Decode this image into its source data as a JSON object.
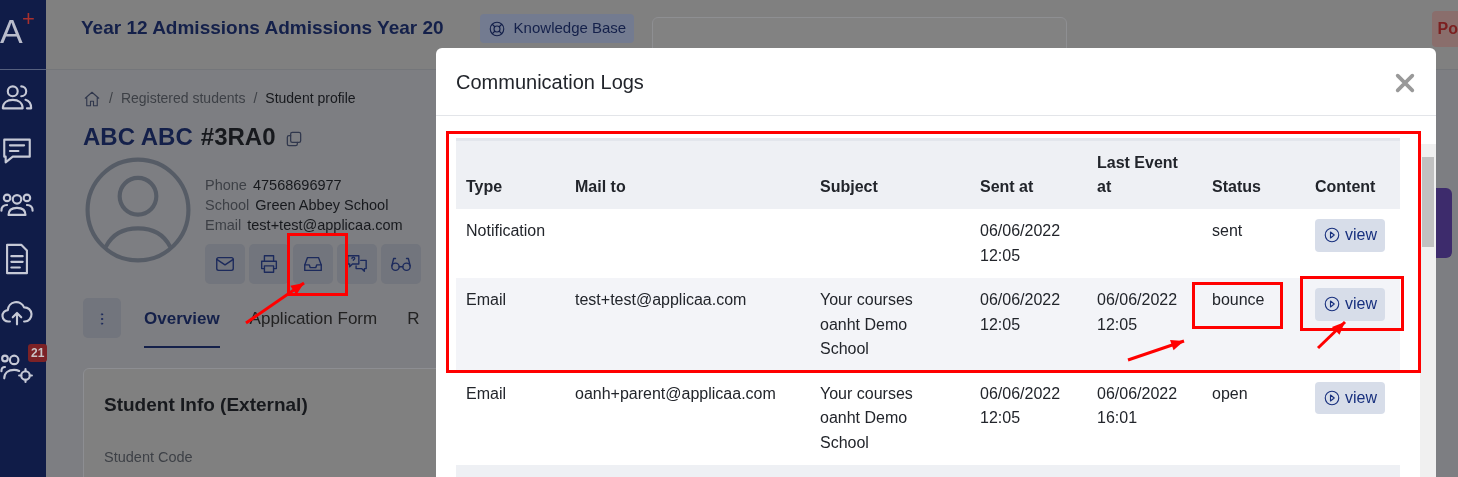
{
  "sidebar": {
    "logo_letter": "A",
    "logo_mark": "+",
    "badge": "21"
  },
  "header": {
    "title": "Year 12 Admissions Admissions Year 20",
    "knowledge_base": "Knowledge Base",
    "right_button": "Po"
  },
  "breadcrumb": [
    {
      "separator": "/",
      "label": "Registered students"
    },
    {
      "separator": "/",
      "label": "Student profile"
    }
  ],
  "student": {
    "name": "ABC ABC",
    "code": "#3RA0",
    "details": [
      {
        "label": "Phone",
        "value": "47568696977"
      },
      {
        "label": "School",
        "value": "Green Abbey School"
      },
      {
        "label": "Email",
        "value": "test+test@applicaa.com"
      }
    ]
  },
  "tabs": [
    {
      "label": "Overview",
      "selected": true
    },
    {
      "label": "Application Form",
      "selected": false
    },
    {
      "label": "R",
      "selected": false
    }
  ],
  "card": {
    "title": "Student Info (External)",
    "field_label": "Student Code"
  },
  "modal": {
    "title": "Communication Logs",
    "columns": [
      "Type",
      "Mail to",
      "Subject",
      "Sent at",
      "Last Event at",
      "Status",
      "Content"
    ],
    "rows": [
      {
        "type": "Notification",
        "mail_to": "",
        "subject": "",
        "sent_at": "06/06/2022 12:05",
        "last_event_at": "",
        "status": "sent",
        "content": "view"
      },
      {
        "type": "Email",
        "mail_to": "test+test@applicaa.com",
        "subject": "Your courses oanht Demo School",
        "sent_at": "06/06/2022 12:05",
        "last_event_at": "06/06/2022 12:05",
        "status": "bounce",
        "content": "view"
      },
      {
        "type": "Email",
        "mail_to": "oanh+parent@applicaa.com",
        "subject": "Your courses oanht Demo School",
        "sent_at": "06/06/2022 12:05",
        "last_event_at": "06/06/2022 16:01",
        "status": "open",
        "content": "view"
      }
    ]
  }
}
